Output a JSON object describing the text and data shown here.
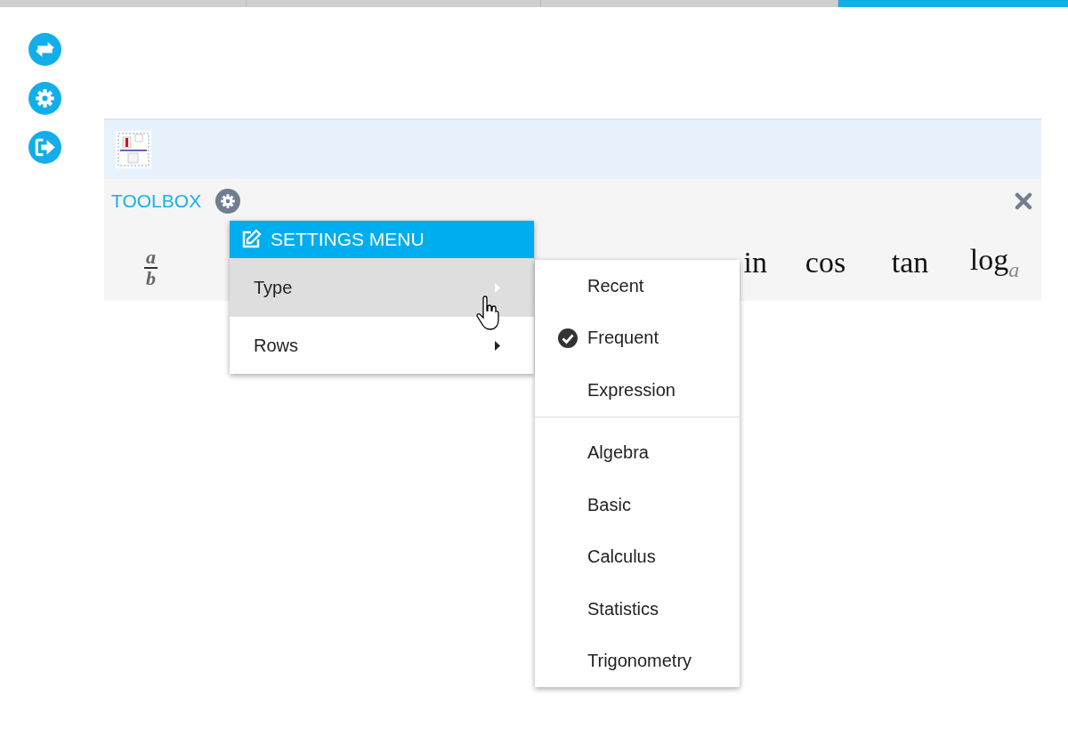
{
  "top_tabs": [
    {
      "selected": false
    },
    {
      "selected": false
    },
    {
      "selected": false
    },
    {
      "selected": true
    }
  ],
  "toolbox": {
    "title": "TOOLBOX",
    "symbols": [
      {
        "kind": "fraction",
        "numerator": "a",
        "denominator": "b"
      },
      {
        "kind": "text",
        "label": "in"
      },
      {
        "kind": "text",
        "label": "cos"
      },
      {
        "kind": "text",
        "label": "tan"
      },
      {
        "kind": "log",
        "label": "log",
        "subscript": "a"
      }
    ]
  },
  "settings_menu": {
    "title": "SETTINGS MENU",
    "items": [
      {
        "label": "Type",
        "selected": true,
        "expanded": true
      },
      {
        "label": "Rows",
        "selected": false,
        "expanded": false
      }
    ]
  },
  "type_submenu": {
    "groups": [
      {
        "items": [
          {
            "label": "Recent",
            "checked": false
          },
          {
            "label": "Frequent",
            "checked": true
          },
          {
            "label": "Expression",
            "checked": false
          }
        ]
      },
      {
        "items": [
          {
            "label": "Algebra",
            "checked": false
          },
          {
            "label": "Basic",
            "checked": false
          },
          {
            "label": "Calculus",
            "checked": false
          },
          {
            "label": "Statistics",
            "checked": false
          },
          {
            "label": "Trigonometry",
            "checked": false
          }
        ]
      }
    ]
  }
}
